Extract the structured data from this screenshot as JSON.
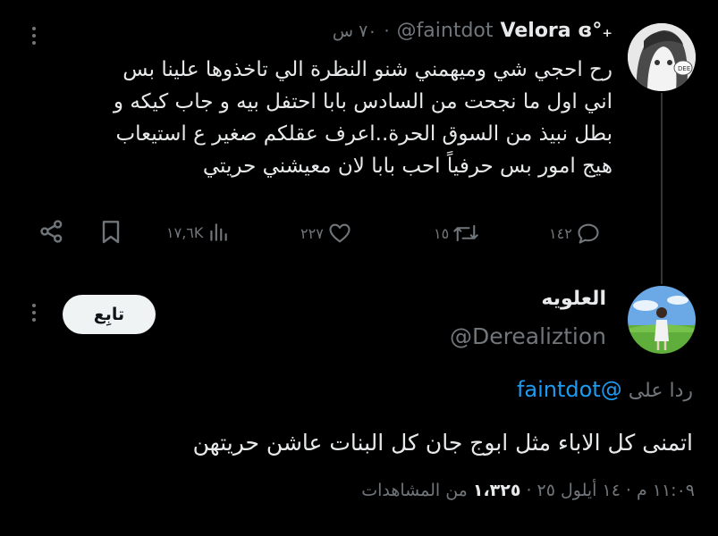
{
  "parent_tweet": {
    "display_name": "Velora ɞ°₊",
    "handle": "@faintdot",
    "separator": "·",
    "time": "٧٠ س",
    "text_lines": [
      "رح احجي شي وميهمني شنو النظرة الي تاخذوها علينا بس",
      "اني اول ما نجحت من السادس بابا احتفل بيه و جاب كيكه و",
      "بطل نبيذ من السوق الحرة..اعرف عقلكم صغير ع استيعاب",
      "هيج امور بس حرفياً احب بابا لان معيشني حريتي"
    ],
    "stats": {
      "replies": "١٤٢",
      "reposts": "١٥",
      "likes": "٢٢٧",
      "views": "١٧,٦K"
    }
  },
  "reply_tweet": {
    "display_name": "العلويه",
    "handle": "@Derealiztion",
    "follow_label": "تابِع",
    "replying_to_prefix": "ردا على",
    "replying_to_handle": "@faintdot",
    "text": "اتمنى كل الاباء مثل ابوج جان كل البنات عاشن حريتهن",
    "meta": {
      "time": "١١:٠٩ م",
      "dot1": "·",
      "date": "١٤ أيلول ٢٥",
      "dot2": "·",
      "views_count": "١،٣٢٥",
      "views_label": "من المشاهدات"
    }
  },
  "icons": [
    "more-dots-icon",
    "reply-icon",
    "repost-icon",
    "like-icon",
    "views-icon",
    "bookmark-icon",
    "share-icon"
  ]
}
